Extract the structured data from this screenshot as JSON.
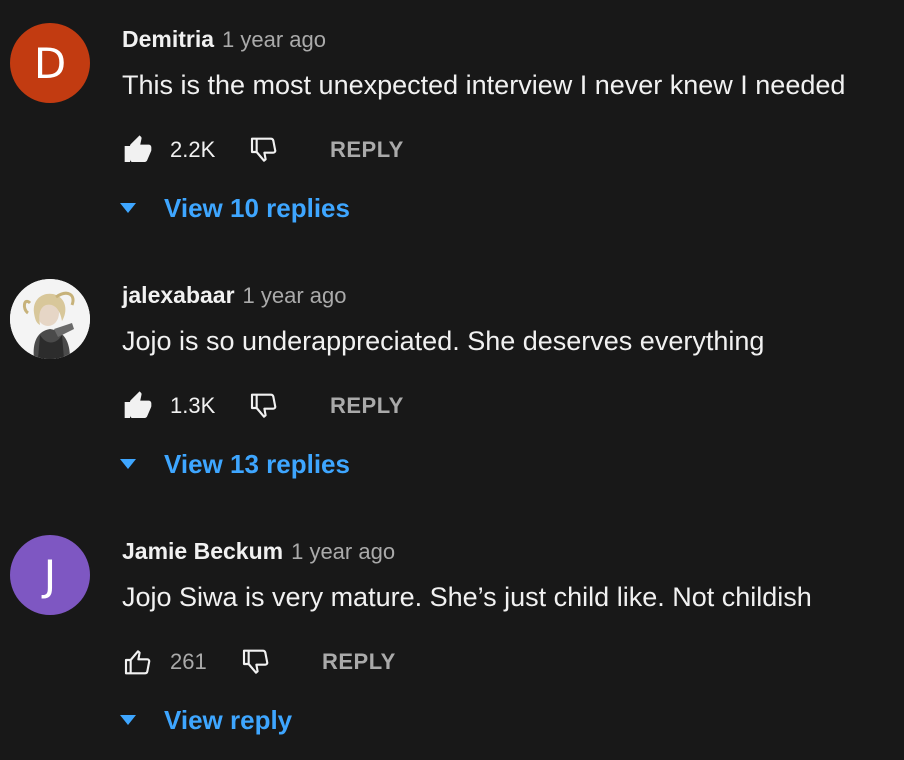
{
  "comments": [
    {
      "author": "Demitria",
      "time": "1 year ago",
      "text": "This is the most unexpected interview I never knew I needed",
      "avatar": {
        "letter": "D",
        "color": "#c23b11"
      },
      "likes": "2.2K",
      "liked": true,
      "reply_label": "REPLY",
      "replies_label": "View 10 replies"
    },
    {
      "author": "jalexabaar",
      "time": "1 year ago",
      "text": "Jojo is so underappreciated. She deserves everything",
      "avatar": {
        "letter": "",
        "color": "#ffffff",
        "type": "photo"
      },
      "likes": "1.3K",
      "liked": true,
      "reply_label": "REPLY",
      "replies_label": "View 13 replies"
    },
    {
      "author": "Jamie Beckum",
      "time": "1 year ago",
      "text": "Jojo Siwa is very mature. She’s just child like. Not childish",
      "avatar": {
        "letter": "J",
        "color": "#7e57c2"
      },
      "likes": "261",
      "liked": false,
      "reply_label": "REPLY",
      "replies_label": "View reply"
    }
  ],
  "icons": {
    "like": "thumb-up-icon",
    "dislike": "thumb-down-icon",
    "expand": "caret-down-icon"
  },
  "colors": {
    "background": "#181818",
    "text": "#f1f1f1",
    "secondary": "#aaaaaa",
    "link": "#3ea6ff"
  }
}
